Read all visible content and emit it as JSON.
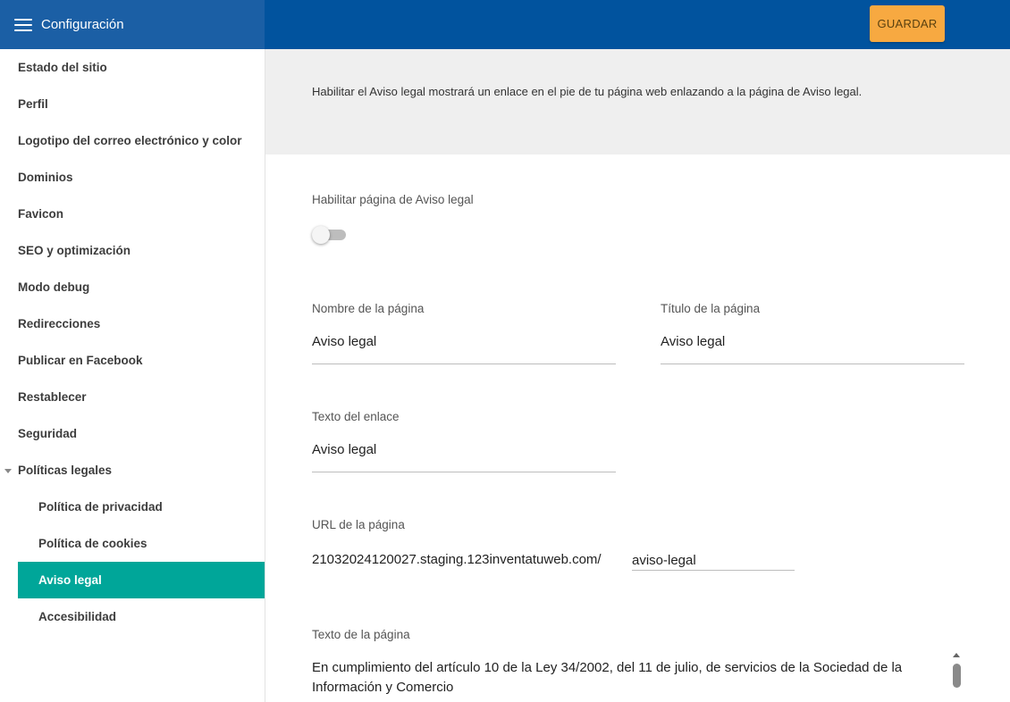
{
  "header": {
    "title": "Configuración",
    "save_label": "GUARDAR"
  },
  "sidebar": {
    "items": [
      {
        "label": "Estado del sitio"
      },
      {
        "label": "Perfil"
      },
      {
        "label": "Logotipo del correo electrónico y color"
      },
      {
        "label": "Dominios"
      },
      {
        "label": "Favicon"
      },
      {
        "label": "SEO y optimización"
      },
      {
        "label": "Modo debug"
      },
      {
        "label": "Redirecciones"
      },
      {
        "label": "Publicar en Facebook"
      },
      {
        "label": "Restablecer"
      },
      {
        "label": "Seguridad"
      },
      {
        "label": "Políticas legales"
      }
    ],
    "subitems": [
      {
        "label": "Política de privacidad"
      },
      {
        "label": "Política de cookies"
      },
      {
        "label": "Aviso legal"
      },
      {
        "label": "Accesibilidad"
      }
    ]
  },
  "main": {
    "info": "Habilitar el Aviso legal mostrará un enlace en el pie de tu página web enlazando a la página de Aviso legal.",
    "enable_label": "Habilitar página de Aviso legal",
    "page_name_label": "Nombre de la página",
    "page_name_value": "Aviso legal",
    "page_title_label": "Título de la página",
    "page_title_value": "Aviso legal",
    "link_text_label": "Texto del enlace",
    "link_text_value": "Aviso legal",
    "url_label": "URL de la página",
    "url_prefix": "21032024120027.staging.123inventatuweb.com/",
    "url_slug": "aviso-legal",
    "page_text_label": "Texto de la página",
    "page_text_value": "En cumplimiento del artículo 10 de la Ley 34/2002, del 11 de julio, de servicios de la Sociedad de la Información y Comercio"
  },
  "colors": {
    "header": "#01539e",
    "active": "#00a699",
    "save": "#f7a941"
  }
}
